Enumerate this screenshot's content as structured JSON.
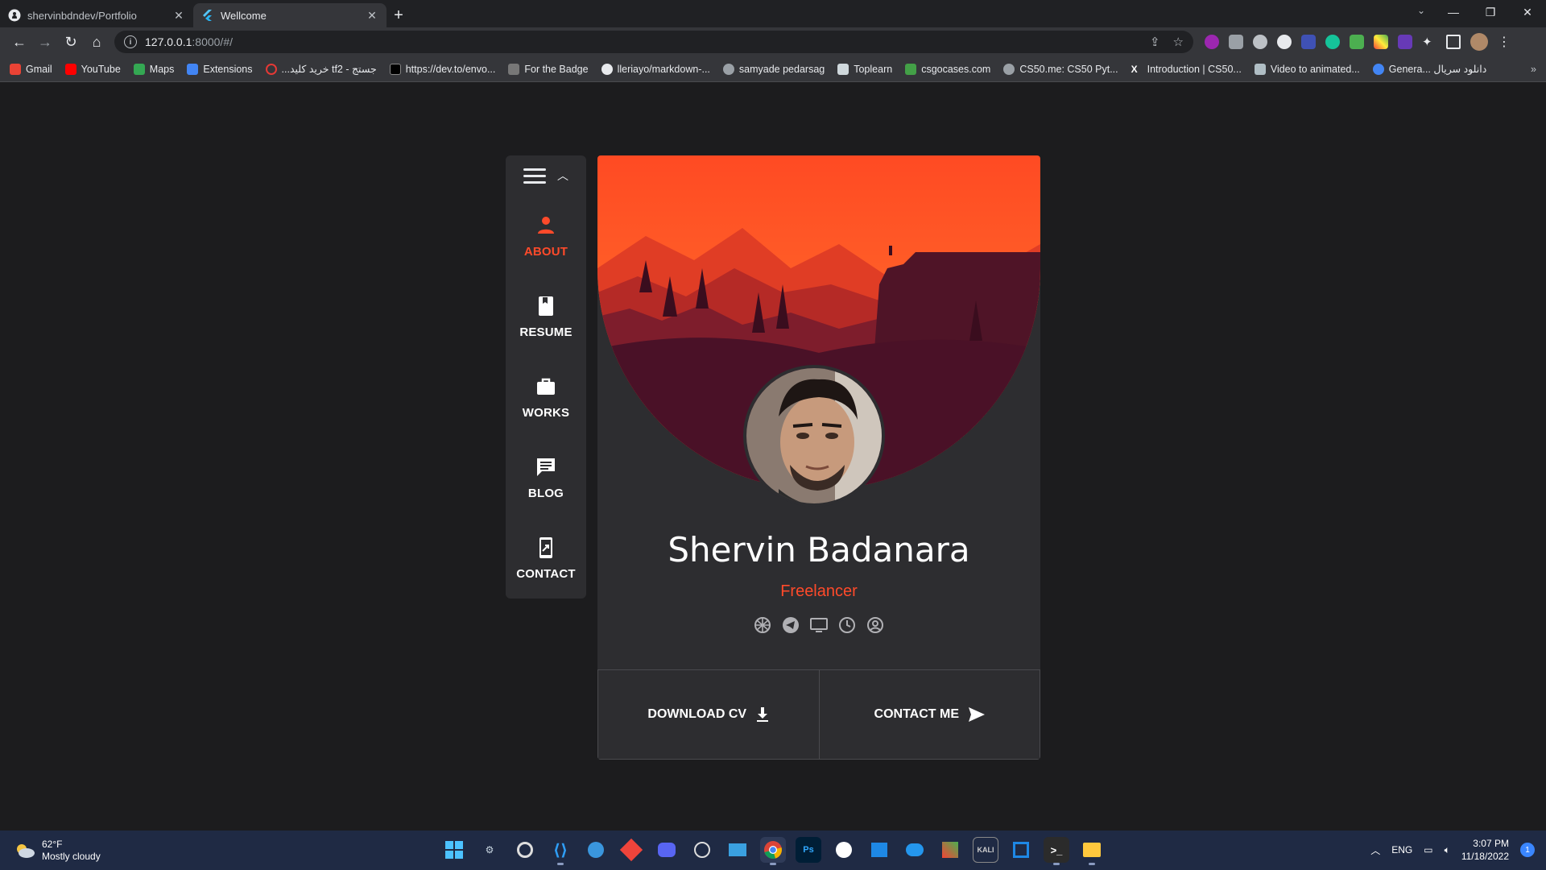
{
  "browser": {
    "tabs": [
      {
        "title": "shervinbdndev/Portfolio",
        "icon": "github-icon",
        "active": false
      },
      {
        "title": "Wellcome",
        "icon": "flutter-icon",
        "active": true
      }
    ],
    "url_host": "127.0.0.1",
    "url_path": ":8000/#/",
    "bookmarks": [
      {
        "label": "Gmail",
        "icon": "gmail-icon"
      },
      {
        "label": "YouTube",
        "icon": "youtube-icon"
      },
      {
        "label": "Maps",
        "icon": "maps-icon"
      },
      {
        "label": "Extensions",
        "icon": "puzzle-icon"
      },
      {
        "label": "...خرید کلید tf2 - جستج",
        "icon": "search-icon"
      },
      {
        "label": "https://dev.to/envo...",
        "icon": "dev-icon"
      },
      {
        "label": "For the Badge",
        "icon": "badge-icon"
      },
      {
        "label": "lleriayo/markdown-...",
        "icon": "github-icon"
      },
      {
        "label": "samyade pedarsag",
        "icon": "globe-icon"
      },
      {
        "label": "Toplearn",
        "icon": "toplearn-icon"
      },
      {
        "label": "csgocases.com",
        "icon": "csgo-icon"
      },
      {
        "label": "CS50.me: CS50 Pyt...",
        "icon": "globe-icon"
      },
      {
        "label": "Introduction | CS50...",
        "icon": "x-icon"
      },
      {
        "label": "Video to animated...",
        "icon": "video-icon"
      },
      {
        "label": "Genera... دانلود سریال",
        "icon": "google-icon"
      }
    ]
  },
  "nav": {
    "items": [
      {
        "label": "ABOUT",
        "icon": "person-icon",
        "active": true
      },
      {
        "label": "RESUME",
        "icon": "bookmark-icon",
        "active": false
      },
      {
        "label": "WORKS",
        "icon": "briefcase-icon",
        "active": false
      },
      {
        "label": "BLOG",
        "icon": "chat-icon",
        "active": false
      },
      {
        "label": "CONTACT",
        "icon": "phone-share-icon",
        "active": false
      }
    ]
  },
  "profile": {
    "name": "Shervin Badanara",
    "role": "Freelancer",
    "socials": [
      "dribbble-icon",
      "telegram-icon",
      "monitor-icon",
      "clock-icon",
      "user-circle-icon"
    ],
    "download_label": "DOWNLOAD CV",
    "contact_label": "CONTACT ME"
  },
  "colors": {
    "accent": "#ff4a2a",
    "page_bg": "#1c1c1e",
    "card_bg": "#2d2d30"
  },
  "taskbar": {
    "weather_temp": "62°F",
    "weather_desc": "Mostly cloudy",
    "lang": "ENG",
    "time": "3:07 PM",
    "date": "11/18/2022",
    "notifications": "1"
  }
}
